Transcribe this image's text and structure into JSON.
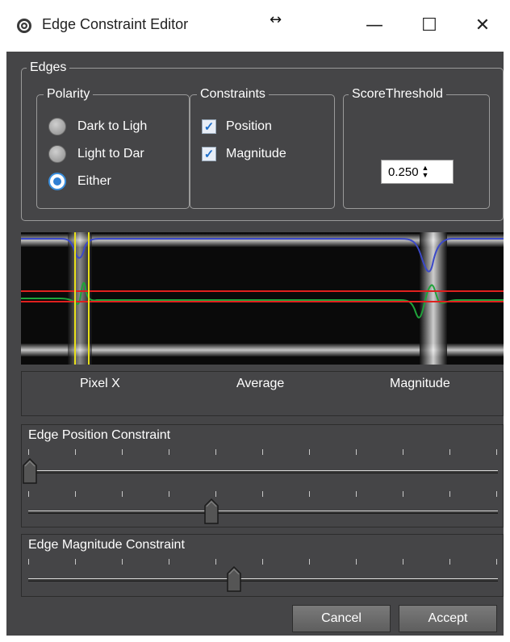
{
  "window": {
    "title": "Edge Constraint Editor",
    "resize_glyph": "↔",
    "minimize_glyph": "—",
    "maximize_glyph": "☐",
    "close_glyph": "✕"
  },
  "edges": {
    "legend": "Edges",
    "polarity": {
      "legend": "Polarity",
      "options": [
        {
          "label": "Dark to Ligh",
          "checked": false
        },
        {
          "label": "Light to Dar",
          "checked": false
        },
        {
          "label": "Either",
          "checked": true
        }
      ]
    },
    "constraints": {
      "legend": "Constraints",
      "items": [
        {
          "label": "Position",
          "checked": true
        },
        {
          "label": "Magnitude",
          "checked": true
        }
      ],
      "check_glyph": "✓"
    },
    "score_threshold": {
      "legend": "ScoreThreshold",
      "value": "0.250",
      "up_glyph": "▲",
      "down_glyph": "▼"
    }
  },
  "graph_labels": {
    "pixel_x": "Pixel X",
    "average": "Average",
    "magnitude": "Magnitude"
  },
  "edge_position_constraint": {
    "title": "Edge Position Constraint",
    "slider1_value": 0.0,
    "slider2_value": 0.4
  },
  "edge_magnitude_constraint": {
    "title": "Edge Magnitude Constraint",
    "slider_value": 0.45
  },
  "buttons": {
    "cancel": "Cancel",
    "accept": "Accept"
  },
  "colors": {
    "panel_bg": "#454547",
    "average_line": "#3b49c8",
    "magnitude_line": "#1fa33a",
    "threshold_line": "#e0201e",
    "marker_line": "#e8e01a"
  }
}
